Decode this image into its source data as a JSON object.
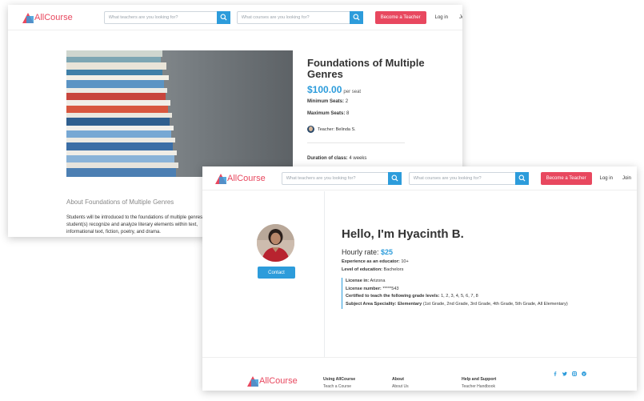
{
  "brand": {
    "name": "AllCourse"
  },
  "header": {
    "teacher_search_placeholder": "What teachers are you looking for?",
    "course_search_placeholder": "What courses are you looking for?",
    "become_teacher_label": "Become a Teacher",
    "login_label": "Log in",
    "join_label": "Join"
  },
  "course": {
    "title": "Foundations of Multiple Genres",
    "price": "$100.00",
    "price_unit": "per seat",
    "min_seats_label": "Minimum Seats:",
    "min_seats_value": "2",
    "max_seats_label": "Maximum Seats:",
    "max_seats_value": "8",
    "teacher_label": "Teacher: Belinda S.",
    "duration_label": "Duration of class:",
    "duration_value": "4 weeks",
    "about_title": "About Foundations of Multiple Genres",
    "about_text": "Students will be introduced to the foundations of multiple genres. student(s) recognize and analyze literary elements within text, informational text, fiction, poetry, and drama."
  },
  "profile": {
    "contact_label": "Contact",
    "greeting": "Hello, I'm Hyacinth B.",
    "rate_label": "Hourly rate:",
    "rate_value": "$25",
    "experience_label": "Experience as an educator:",
    "experience_value": "10+",
    "education_label": "Level of education:",
    "education_value": "Bachelors",
    "license_in_label": "License in:",
    "license_in_value": "Arizona",
    "license_number_label": "License number:",
    "license_number_value": "*****543",
    "grades_label": "Certified to teach the following grade levels:",
    "grades_value": "1, 2, 3, 4, 5, 6, 7, 8",
    "speciality_label": "Subject Area Speciality: Elementary",
    "speciality_value": "(1st Grade, 2nd Grade, 3rd Grade, 4th Grade, 5th Grade, All Elementary)"
  },
  "footer": {
    "col1_heading": "Using AllCourse",
    "col1_link": "Teach a Course",
    "col2_heading": "About",
    "col2_link": "About Us",
    "col3_heading": "Help and Support",
    "col3_link": "Teacher Handbook",
    "social_icons": [
      "facebook-icon",
      "twitter-icon",
      "instagram-icon",
      "vimeo-icon"
    ]
  },
  "colors": {
    "brand_red": "#e8485f",
    "accent_blue": "#2d9cdb"
  }
}
